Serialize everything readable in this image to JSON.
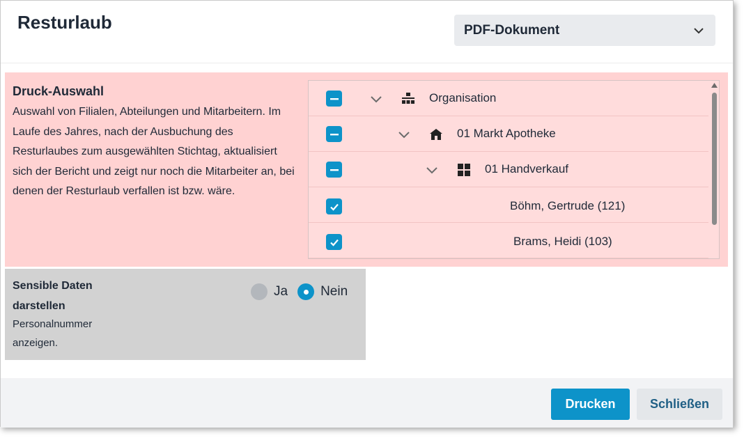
{
  "dialog": {
    "title": "Resturlaub",
    "format_select": {
      "value": "PDF-Dokument"
    }
  },
  "print_selection": {
    "heading": "Druck-Auswahl",
    "description": "Auswahl von Filialen, Abteilungen und Mitarbeitern. Im Laufe des Jahres, nach der Ausbuchung des Resturlaubes zum ausgewählten Stichtag, aktualisiert sich der Bericht und zeigt nur noch die Mitarbeiter an, bei denen der Resturlaub verfallen ist bzw. wäre.",
    "tree": [
      {
        "label": "Organisation",
        "state": "indeterminate",
        "icon": "sitemap-icon",
        "level": 0
      },
      {
        "label": "01 Markt Apotheke",
        "state": "indeterminate",
        "icon": "store-icon",
        "level": 1
      },
      {
        "label": "01 Handverkauf",
        "state": "indeterminate",
        "icon": "grid-icon",
        "level": 2
      },
      {
        "label": "Böhm, Gertrude (121)",
        "state": "checked",
        "level": 3
      },
      {
        "label": "Brams, Heidi (103)",
        "state": "checked",
        "level": 3
      }
    ]
  },
  "sensitive_data": {
    "heading": "Sensible Daten darstellen",
    "subtext": "Personalnummer anzeigen.",
    "options": [
      {
        "label": "Ja",
        "selected": false
      },
      {
        "label": "Nein",
        "selected": true
      }
    ]
  },
  "footer": {
    "print_label": "Drucken",
    "close_label": "Schließen"
  },
  "colors": {
    "accent": "#0d93c9",
    "selection_bg": "#ffd2d2",
    "sensitive_bg": "#d2d2d2"
  }
}
